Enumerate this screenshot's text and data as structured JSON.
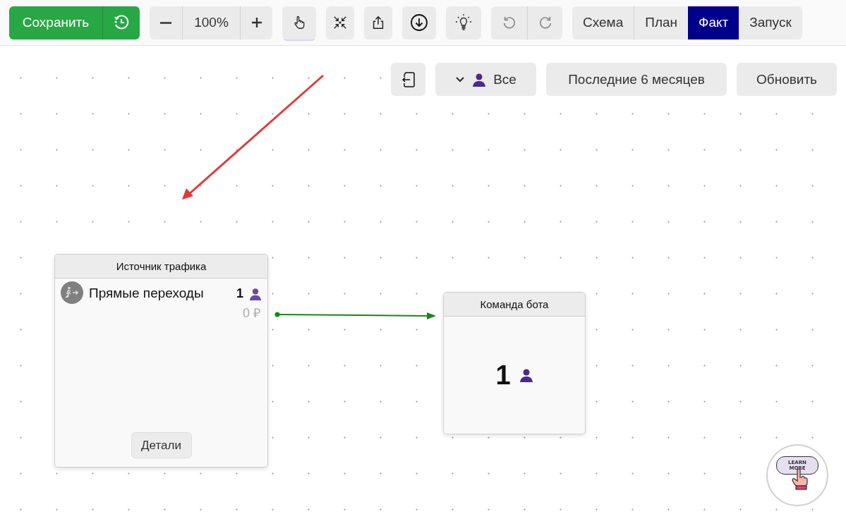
{
  "toolbar": {
    "save_button": "Сохранить",
    "zoom_value": "100%",
    "hand_tool": {
      "selected": true
    },
    "undo": {
      "disabled": true
    },
    "redo": {
      "disabled": true
    },
    "modes": [
      {
        "label": "Схема",
        "selected": false
      },
      {
        "label": "План",
        "selected": false
      },
      {
        "label": "Факт",
        "selected": true
      },
      {
        "label": "Запуск",
        "selected": false
      }
    ]
  },
  "filters": {
    "audience": "Все",
    "period": "Последние 6 месяцев",
    "refresh": "Обновить"
  },
  "nodes": [
    {
      "kind": "source",
      "title": "Источник трафика",
      "items": [
        {
          "name": "Прямые переходы",
          "count": "1",
          "amount": "0 ₽"
        }
      ],
      "details_button": "Детали"
    },
    {
      "kind": "command",
      "title": "Команда бота",
      "count": "1"
    }
  ],
  "learn_more": {
    "lines": [
      "LEARN",
      "MORE"
    ]
  }
}
